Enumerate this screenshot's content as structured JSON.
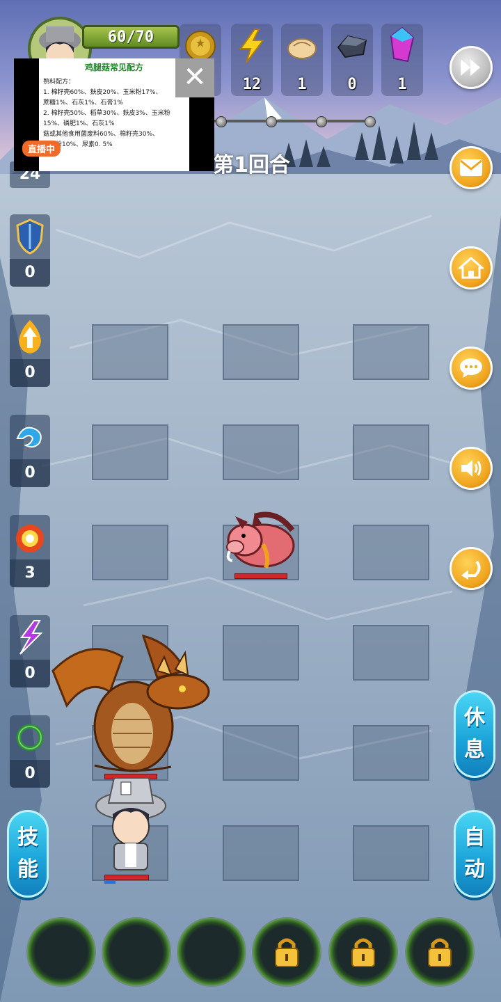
{
  "hud": {
    "hp": "60/70",
    "resources": [
      {
        "name": "gold-coin",
        "value": ""
      },
      {
        "name": "energy",
        "value": "12"
      },
      {
        "name": "bun",
        "value": "1"
      },
      {
        "name": "iron-ore",
        "value": "0"
      },
      {
        "name": "crystal",
        "value": "1"
      }
    ],
    "round_label": "第1回合",
    "left_count": "24"
  },
  "ad": {
    "title": "鸡腿菇常见配方",
    "lines": [
      "熟料配方：",
      "1. 棉籽壳60%、麸皮20%、玉米粉17%、",
      "蔗糖1%、石灰1%、石膏1%",
      "2. 棉籽壳50%、稻草30%、麸皮3%、玉米粉",
      "15%、磷肥1%、石灰1%",
      "菇或其他食用菌废料60%、棉籽壳30%、",
      "玉米粉10%、尿素0. 5%"
    ],
    "live_label": "直播中",
    "close": "✕"
  },
  "skills": [
    {
      "icon": "shield-icon",
      "count": "0"
    },
    {
      "icon": "flame-arrow-icon",
      "count": "0"
    },
    {
      "icon": "water-wave-icon",
      "count": "0"
    },
    {
      "icon": "fire-burst-icon",
      "count": "3"
    },
    {
      "icon": "lightning-claw-icon",
      "count": "0"
    },
    {
      "icon": "green-ring-icon",
      "count": "0"
    }
  ],
  "buttons": {
    "rest": [
      "休",
      "息"
    ],
    "auto": [
      "自",
      "动"
    ],
    "skill": [
      "技",
      "能"
    ]
  },
  "colors": {
    "accent": "#f0a41e",
    "pill": "#1aa2d8",
    "hp_bar": "#d3262b"
  }
}
